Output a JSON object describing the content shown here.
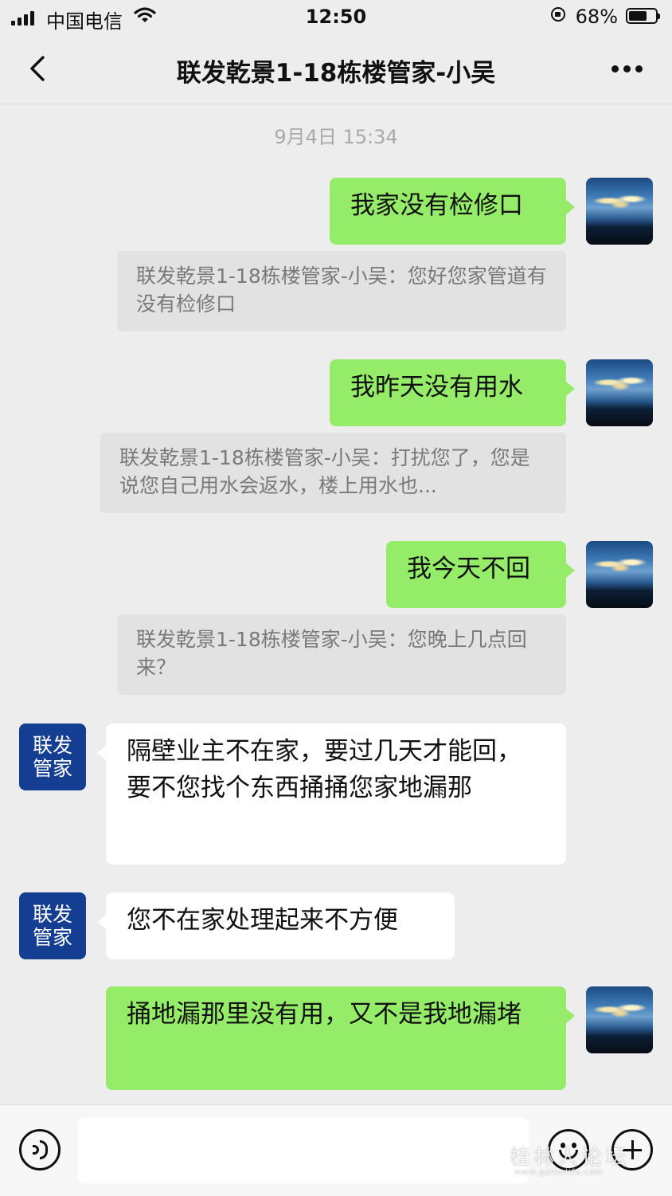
{
  "status_bar": {
    "carrier": "中国电信",
    "time": "12:50",
    "battery": "68%",
    "battery_level": 0.68
  },
  "header": {
    "title": "联发乾景1-18栋楼管家-小吴"
  },
  "timestamp": "9月4日 15:34",
  "messages": [
    {
      "text": "我家没有检修口",
      "quote": "联发乾景1-18栋楼管家-小吴：您好您家管道有没有检修口"
    },
    {
      "text": "我昨天没有用水",
      "quote": "联发乾景1-18栋楼管家-小吴：打扰您了，您是说您自己用水会返水，楼上用水也..."
    },
    {
      "text": "我今天不回",
      "quote": "联发乾景1-18栋楼管家-小吴：您晚上几点回来？"
    },
    {
      "text": "隔壁业主不在家，要过几天才能回，要不您找个东西捅捅您家地漏那"
    },
    {
      "text": "您不在家处理起来不方便"
    },
    {
      "text": "捅地漏那里没有用，又不是我地漏堵"
    }
  ],
  "bot_avatar": {
    "line1": "联发",
    "line2": "管家"
  },
  "input_bar": {
    "placeholder": ""
  },
  "watermark": {
    "text": "桂林人论坛",
    "sub": "www.guilinlife.com"
  },
  "colors": {
    "my_bubble": "#95ec69",
    "their_bubble": "#ffffff",
    "background": "#ededed",
    "bot_avatar": "#143e91"
  }
}
